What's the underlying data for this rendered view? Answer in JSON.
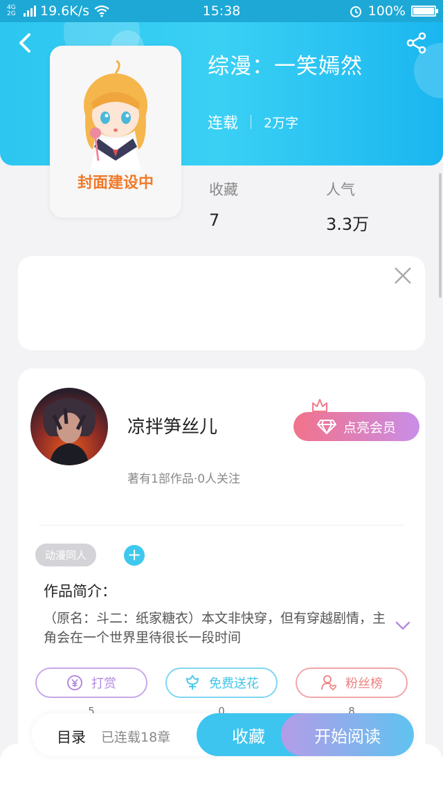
{
  "status_bar": {
    "network": "4G 2G",
    "speed": "19.6K/s",
    "time": "15:38",
    "battery": "100%"
  },
  "book": {
    "title": "综漫：一笑嫣然",
    "status": "连载",
    "word_count": "2万字",
    "cover_text": "封面建设中",
    "favorites_label": "收藏",
    "favorites_value": "7",
    "popularity_label": "人气",
    "popularity_value": "3.3万"
  },
  "author": {
    "name": "凉拌笋丝儿",
    "stats": "著有1部作品·0人关注",
    "vip_label": "点亮会员"
  },
  "tags": [
    "动漫同人"
  ],
  "intro": {
    "label": "作品简介：",
    "text": "（原名：斗二：纸家糖衣）本文非快穿，但有穿越剧情，主角会在一个世界里待很长一段时间"
  },
  "actions": [
    {
      "label": "打赏",
      "count": "5",
      "color": "#b48ae0",
      "icon": "yen-coin-icon"
    },
    {
      "label": "免费送花",
      "count": "0",
      "color": "#3fc4ea",
      "icon": "flower-icon"
    },
    {
      "label": "粉丝榜",
      "count": "8",
      "color": "#ef8080",
      "icon": "fan-rank-icon"
    }
  ],
  "bottom_bar": {
    "toc_label": "目录",
    "chapters": "已连载18章",
    "favorite_label": "收藏",
    "read_label": "开始阅读"
  }
}
